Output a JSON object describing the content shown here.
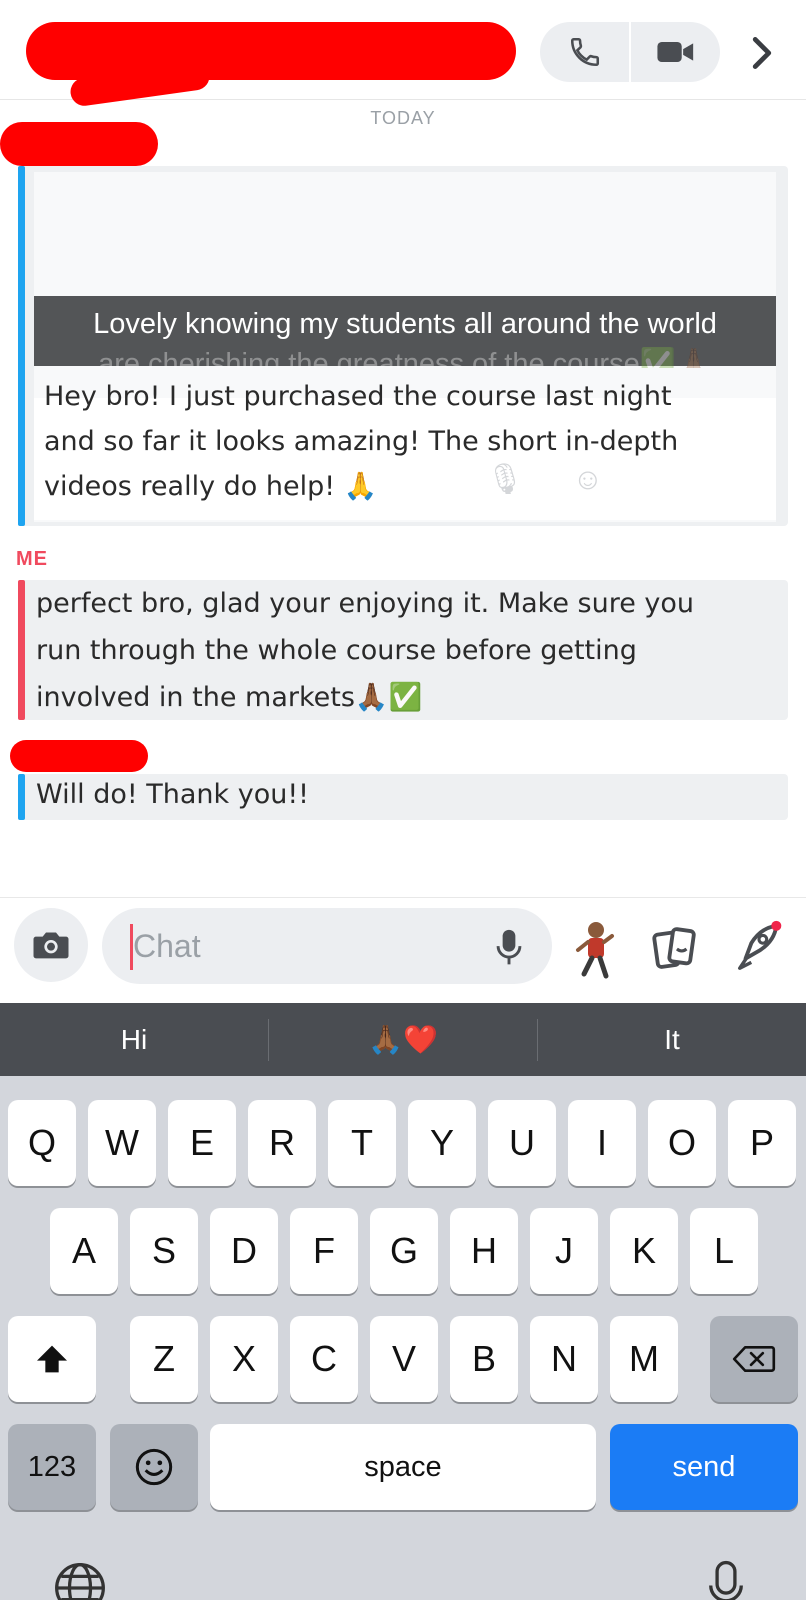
{
  "header": {
    "actions": [
      "phone-call",
      "video-call",
      "chevron-right"
    ]
  },
  "chat": {
    "day_label": "TODAY",
    "snap_caption": "Lovely knowing my students all around the world",
    "snap_caption_partial": "are cherishing the greatness of the course✅🙏🏾",
    "messages": [
      {
        "sender": "",
        "lines": [
          "Hey bro! I just purchased the course last night",
          "and so far it looks amazing! The short in-depth",
          "videos really do help! 🙏"
        ]
      },
      {
        "sender": "ME",
        "lines": [
          "perfect bro, glad your enjoying it. Make sure you",
          "run through the whole course before getting",
          "involved in the markets🙏🏾✅"
        ]
      },
      {
        "sender": "",
        "lines": [
          "Will do! Thank you!!"
        ]
      }
    ]
  },
  "composer": {
    "placeholder": "Chat"
  },
  "suggestions": [
    "Hi",
    "🙏🏾❤️",
    "It"
  ],
  "keyboard": {
    "row1": [
      "Q",
      "W",
      "E",
      "R",
      "T",
      "Y",
      "U",
      "I",
      "O",
      "P"
    ],
    "row2": [
      "A",
      "S",
      "D",
      "F",
      "G",
      "H",
      "J",
      "K",
      "L"
    ],
    "row3": [
      "Z",
      "X",
      "C",
      "V",
      "B",
      "N",
      "M"
    ],
    "numbers_label": "123",
    "space_label": "space",
    "send_label": "send"
  },
  "colors": {
    "accent_blue": "#1ea4f0",
    "accent_red": "#f04a5e",
    "send_blue": "#1b7cf5"
  }
}
